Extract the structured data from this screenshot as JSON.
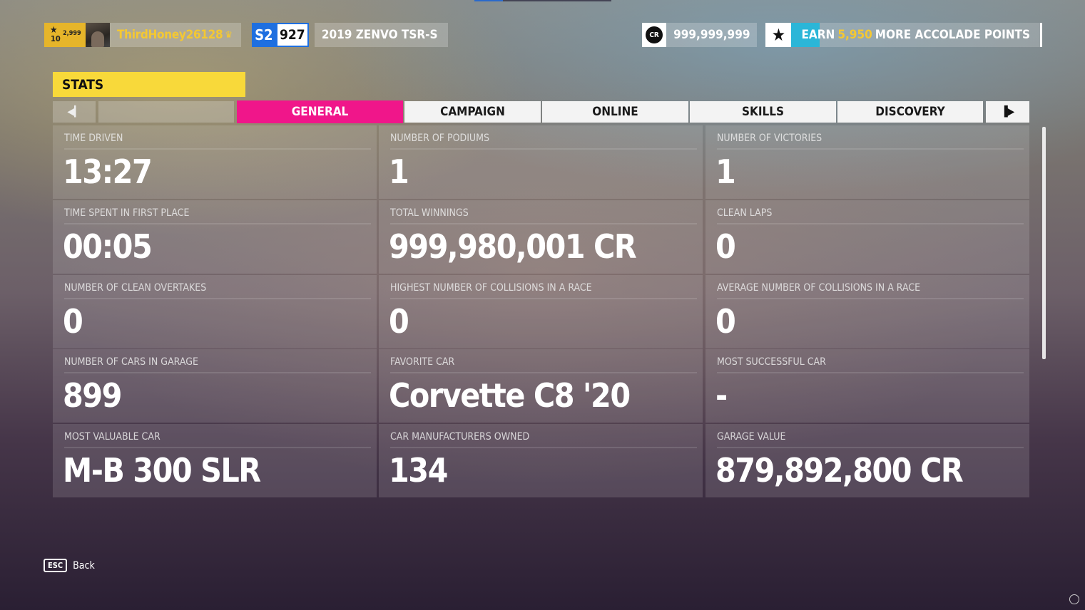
{
  "profile": {
    "rank_level": "10",
    "rank_points": "2,999",
    "gamertag": "ThirdHoney26128",
    "car_class": "S2",
    "car_pi": "927",
    "car_name": "2019 ZENVO TSR-S"
  },
  "currency": {
    "cr_icon": "CR",
    "credits": "999,999,999"
  },
  "accolades": {
    "prefix": "EARN",
    "amount": "5,950",
    "suffix": "MORE ACCOLADE POINTS"
  },
  "page": {
    "title": "STATS"
  },
  "tabs": [
    {
      "label": "GENERAL",
      "active": true
    },
    {
      "label": "CAMPAIGN",
      "active": false
    },
    {
      "label": "ONLINE",
      "active": false
    },
    {
      "label": "SKILLS",
      "active": false
    },
    {
      "label": "DISCOVERY",
      "active": false
    }
  ],
  "stats": [
    {
      "label": "TIME DRIVEN",
      "value": "13:27"
    },
    {
      "label": "NUMBER OF PODIUMS",
      "value": "1"
    },
    {
      "label": "NUMBER OF VICTORIES",
      "value": "1"
    },
    {
      "label": "TIME SPENT IN FIRST PLACE",
      "value": "00:05"
    },
    {
      "label": "TOTAL WINNINGS",
      "value": "999,980,001 CR"
    },
    {
      "label": "CLEAN LAPS",
      "value": "0"
    },
    {
      "label": "NUMBER OF CLEAN OVERTAKES",
      "value": "0"
    },
    {
      "label": "HIGHEST NUMBER OF COLLISIONS IN A RACE",
      "value": "0"
    },
    {
      "label": "AVERAGE NUMBER OF COLLISIONS IN A RACE",
      "value": "0"
    },
    {
      "label": "NUMBER OF CARS IN GARAGE",
      "value": "899"
    },
    {
      "label": "FAVORITE CAR",
      "value": "Corvette C8 '20"
    },
    {
      "label": "MOST SUCCESSFUL CAR",
      "value": "-"
    },
    {
      "label": "MOST VALUABLE CAR",
      "value": "M-B 300 SLR"
    },
    {
      "label": "CAR MANUFACTURERS OWNED",
      "value": "134"
    },
    {
      "label": "GARAGE VALUE",
      "value": "879,892,800 CR"
    }
  ],
  "footer": {
    "esc_key": "ESC",
    "back_label": "Back"
  }
}
